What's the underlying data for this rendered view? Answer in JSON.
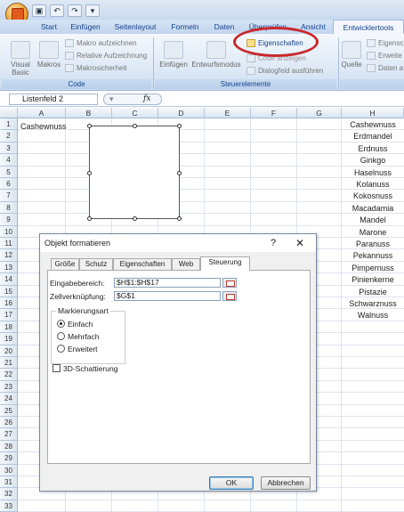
{
  "quick_access": {
    "office_button": "office-logo-icon",
    "save": "save-icon",
    "undo": "undo-icon",
    "redo": "redo-icon",
    "customize": "▾"
  },
  "tabs": [
    "Start",
    "Einfügen",
    "Seitenlayout",
    "Formeln",
    "Daten",
    "Überprüfen",
    "Ansicht",
    "Entwicklertools"
  ],
  "active_tab": "Entwicklertools",
  "ribbon": {
    "code": {
      "label": "Code",
      "visual_basic": "Visual Basic",
      "makros": "Makros",
      "makro_aufzeichnen": "Makro aufzeichnen",
      "relative_aufzeichnung": "Relative Aufzeichnung",
      "makrosicherheit": "Makrosicherheit"
    },
    "steuerelemente": {
      "label": "Steuerelemente",
      "einfuegen": "Einfügen",
      "entwurfsmodus": "Entwurfsmodus",
      "eigenschaften": "Eigenschaften",
      "code_anzeigen": "Code anzeigen",
      "dialogfeld": "Dialogfeld ausführen"
    },
    "xml": {
      "quelle": "Quelle",
      "eigenschaften": "Eigensc",
      "erweiterungspakete": "Erweite",
      "daten": "Daten a"
    }
  },
  "namebox": "Listenfeld 2",
  "fx": "fx",
  "columns": [
    "A",
    "B",
    "C",
    "D",
    "E",
    "F",
    "G",
    "H"
  ],
  "rows": [
    "1",
    "2",
    "3",
    "4",
    "5",
    "6",
    "7",
    "8",
    "9",
    "10",
    "11",
    "12",
    "13",
    "14",
    "15",
    "16",
    "17",
    "18",
    "19",
    "20",
    "21",
    "22",
    "23",
    "24",
    "25",
    "26",
    "27",
    "28",
    "29",
    "30",
    "31",
    "32",
    "33"
  ],
  "cell_g1": "Cashewnuss",
  "column_h": [
    "Cashewnuss",
    "Erdmandel",
    "Erdnuss",
    "Ginkgo",
    "Haselnuss",
    "Kolanuss",
    "Kokosnuss",
    "Macadamia",
    "Mandel",
    "Marone",
    "Paranuss",
    "Pekannuss",
    "Pimpernuss",
    "Pinienkerne",
    "Pistazie",
    "Schwarznuss",
    "Walnuss"
  ],
  "dialog": {
    "title": "Objekt formatieren",
    "help": "?",
    "close": "✕",
    "tabs": [
      "Größe",
      "Schutz",
      "Eigenschaften",
      "Web",
      "Steuerung"
    ],
    "active_tab": "Steuerung",
    "eingabebereich_label": "Eingabebereich:",
    "eingabebereich_value": "$H$1:$H$17",
    "zellverknuepfung_label": "Zellverknüpfung:",
    "zellverknuepfung_value": "$G$1",
    "markierungsart_label": "Markierungsart",
    "radio_einfach": "Einfach",
    "radio_mehrfach": "Mehrfach",
    "radio_erweitert": "Erweitert",
    "selected_radio": "Einfach",
    "schattierung_label": "3D-Schattierung",
    "schattierung_checked": false,
    "ok": "OK",
    "abbrechen": "Abbrechen"
  },
  "colors": {
    "highlight": "#c8282c",
    "ribbon_text": "#15428b"
  }
}
